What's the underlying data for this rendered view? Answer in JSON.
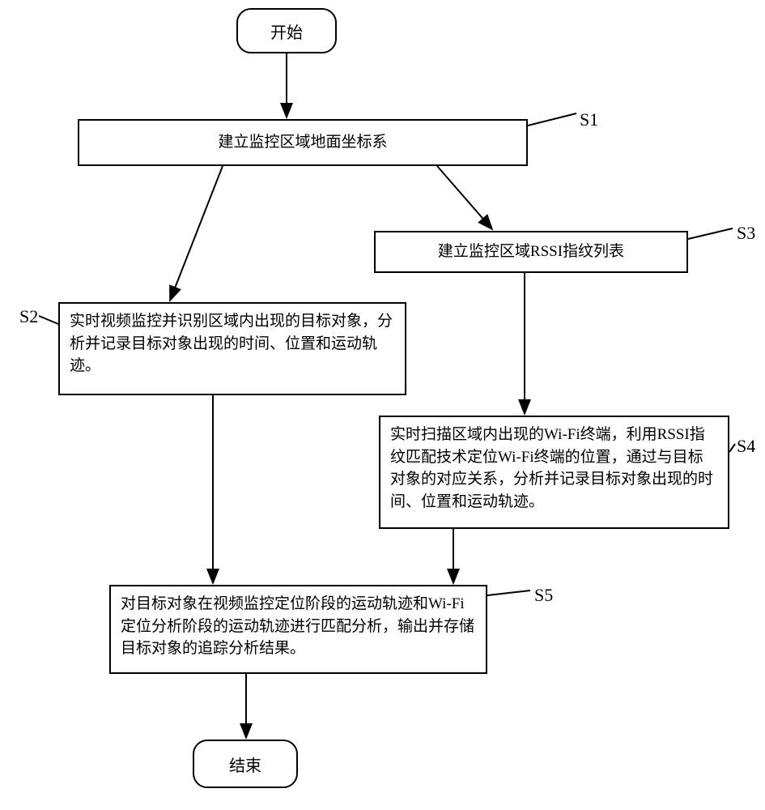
{
  "chart_data": {
    "type": "flowchart",
    "nodes": [
      {
        "id": "start",
        "kind": "terminal",
        "text": "开始"
      },
      {
        "id": "S1",
        "kind": "process",
        "label": "S1",
        "text": "建立监控区域地面坐标系"
      },
      {
        "id": "S2",
        "kind": "process",
        "label": "S2",
        "text": "实时视频监控并识别区域内出现的目标对象，分析并记录目标对象出现的时间、位置和运动轨迹。"
      },
      {
        "id": "S3",
        "kind": "process",
        "label": "S3",
        "text": "建立监控区域RSSI指纹列表"
      },
      {
        "id": "S4",
        "kind": "process",
        "label": "S4",
        "text": "实时扫描区域内出现的Wi-Fi终端，利用RSSI指纹匹配技术定位Wi-Fi终端的位置，通过与目标对象的对应关系，分析并记录目标对象出现的时间、位置和运动轨迹。"
      },
      {
        "id": "S5",
        "kind": "process",
        "label": "S5",
        "text": "对目标对象在视频监控定位阶段的运动轨迹和Wi-Fi定位分析阶段的运动轨迹进行匹配分析，输出并存储目标对象的追踪分析结果。"
      },
      {
        "id": "end",
        "kind": "terminal",
        "text": "结束"
      }
    ],
    "edges": [
      {
        "from": "start",
        "to": "S1"
      },
      {
        "from": "S1",
        "to": "S2"
      },
      {
        "from": "S1",
        "to": "S3"
      },
      {
        "from": "S2",
        "to": "S5"
      },
      {
        "from": "S3",
        "to": "S4"
      },
      {
        "from": "S4",
        "to": "S5"
      },
      {
        "from": "S5",
        "to": "end"
      }
    ]
  },
  "labels": {
    "start": "开始",
    "s1": "建立监控区域地面坐标系",
    "s2": "实时视频监控并识别区域内出现的目标对象，分析并记录目标对象出现的时间、位置和运动轨迹。",
    "s3": "建立监控区域RSSI指纹列表",
    "s4": "实时扫描区域内出现的Wi-Fi终端，利用RSSI指纹匹配技术定位Wi-Fi终端的位置，通过与目标对象的对应关系，分析并记录目标对象出现的时间、位置和运动轨迹。",
    "s5": "对目标对象在视频监控定位阶段的运动轨迹和Wi-Fi定位分析阶段的运动轨迹进行匹配分析，输出并存储目标对象的追踪分析结果。",
    "end": "结束",
    "tag_s1": "S1",
    "tag_s2": "S2",
    "tag_s3": "S3",
    "tag_s4": "S4",
    "tag_s5": "S5"
  }
}
